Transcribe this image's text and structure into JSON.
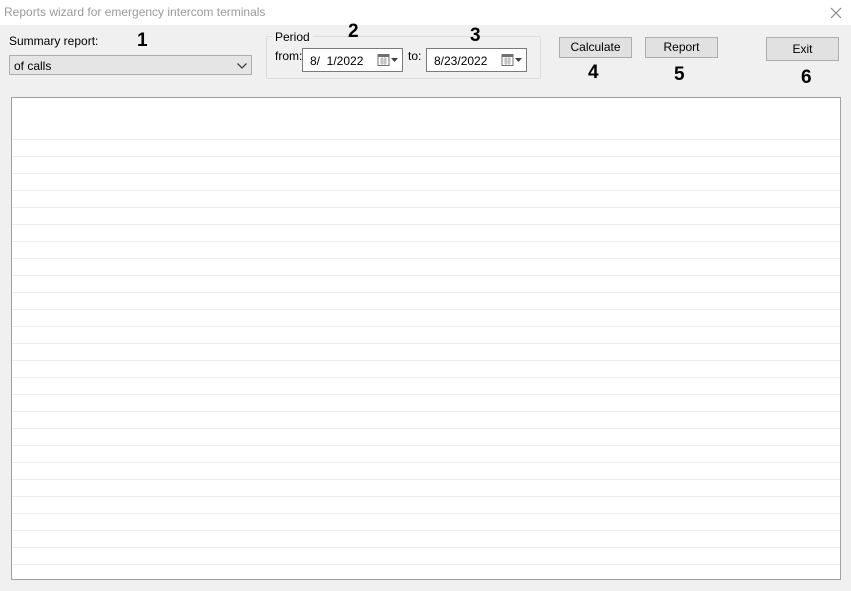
{
  "window": {
    "title": "Reports wizard for emergency intercom terminals"
  },
  "summary": {
    "label": "Summary report:",
    "selected": "of calls"
  },
  "period": {
    "legend": "Period",
    "from_label": "from:",
    "from_value": "8/  1/2022",
    "to_label": "to:",
    "to_value": "8/23/2022"
  },
  "buttons": {
    "calculate": "Calculate",
    "report": "Report",
    "exit": "Exit"
  },
  "callouts": [
    "1",
    "2",
    "3",
    "4",
    "5",
    "6"
  ],
  "icons": {
    "close": "close-icon",
    "dropdown": "chevron-down-icon",
    "calendar": "calendar-icon"
  },
  "colors": {
    "window_bg": "#f0f0f0",
    "title_text": "#9a9a9a",
    "button_bg": "#e1e1e1",
    "button_border": "#adadad",
    "report_lines": "#ececec"
  }
}
